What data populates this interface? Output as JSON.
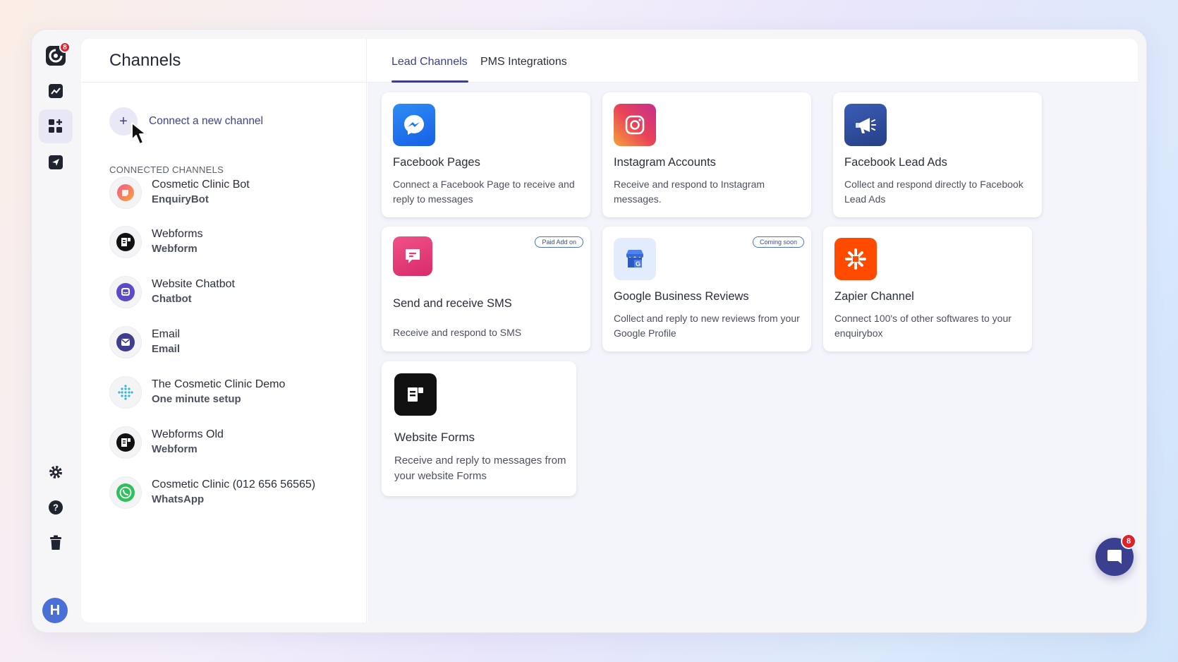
{
  "sidebar": {
    "logo_badge": "8",
    "avatar_initial": "H"
  },
  "header": {
    "title": "Channels"
  },
  "connect_label": "Connect a new channel",
  "section_label": "CONNECTED CHANNELS",
  "connected_channels": [
    {
      "name": "Cosmetic Clinic Bot",
      "type": "EnquiryBot"
    },
    {
      "name": "Webforms",
      "type": "Webform"
    },
    {
      "name": "Website Chatbot",
      "type": "Chatbot"
    },
    {
      "name": "Email",
      "type": "Email"
    },
    {
      "name": "The Cosmetic Clinic Demo",
      "type": "One minute setup"
    },
    {
      "name": "Webforms Old",
      "type": "Webform"
    },
    {
      "name": "Cosmetic Clinic (012 656 56565)",
      "type": "WhatsApp"
    }
  ],
  "tabs": [
    {
      "label": "Lead Channels",
      "active": true
    },
    {
      "label": "PMS Integrations",
      "active": false
    }
  ],
  "cards": [
    {
      "title": "Facebook Pages",
      "desc": "Connect a Facebook Page to receive and reply to messages",
      "icon": "messenger-icon"
    },
    {
      "title": "Instagram Accounts",
      "desc": "Receive and respond to Instagram messages.",
      "icon": "instagram-icon"
    },
    {
      "title": "Facebook Lead Ads",
      "desc": "Collect and respond directly to Facebook Lead Ads",
      "icon": "megaphone-icon"
    },
    {
      "title": "Send and receive SMS",
      "desc": "Receive and respond to SMS",
      "icon": "sms-icon",
      "pill": "Paid Add on"
    },
    {
      "title": "Google Business Reviews",
      "desc": "Collect and reply to new reviews from your Google Profile",
      "icon": "google-business-icon",
      "pill": "Coming soon"
    },
    {
      "title": "Zapier Channel",
      "desc": "Connect 100's of other softwares to your enquirybox",
      "icon": "zapier-icon"
    },
    {
      "title": "Website Forms",
      "desc": "Receive and reply to messages from your website Forms",
      "icon": "webform-icon"
    }
  ],
  "chat_fab_badge": "8",
  "colors": {
    "accent": "#3a3f8f",
    "badge": "#e0202b"
  }
}
